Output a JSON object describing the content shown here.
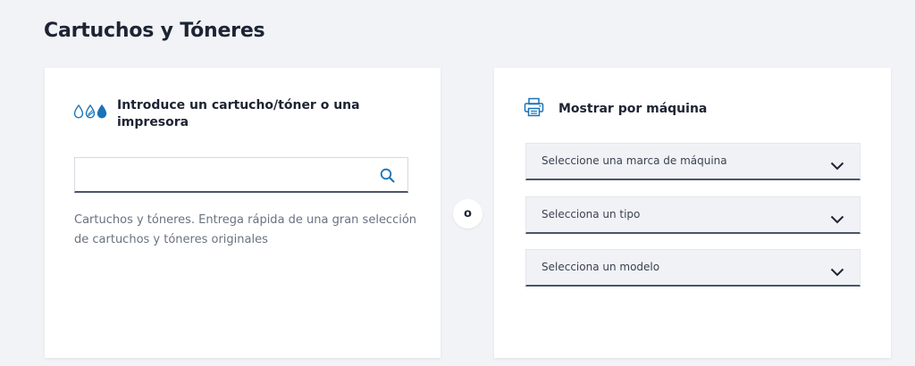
{
  "page": {
    "title": "Cartuchos y Tóneres"
  },
  "search_card": {
    "title": "Introduce un cartucho/tóner o una impresora",
    "icon": "ink-drops-icon",
    "input_value": "",
    "description": "Cartuchos y tóneres. Entrega rápida de una gran selección de cartuchos y tóneres originales"
  },
  "divider": {
    "label": "o"
  },
  "machine_card": {
    "title": "Mostrar por máquina",
    "icon": "printer-icon",
    "selects": [
      {
        "label": "Seleccione una marca de máquina"
      },
      {
        "label": "Selecciona un tipo"
      },
      {
        "label": "Selecciona un modelo"
      }
    ]
  },
  "colors": {
    "background": "#f2f3f7",
    "accent": "#1a73b8",
    "text_dark": "#1d2433"
  }
}
